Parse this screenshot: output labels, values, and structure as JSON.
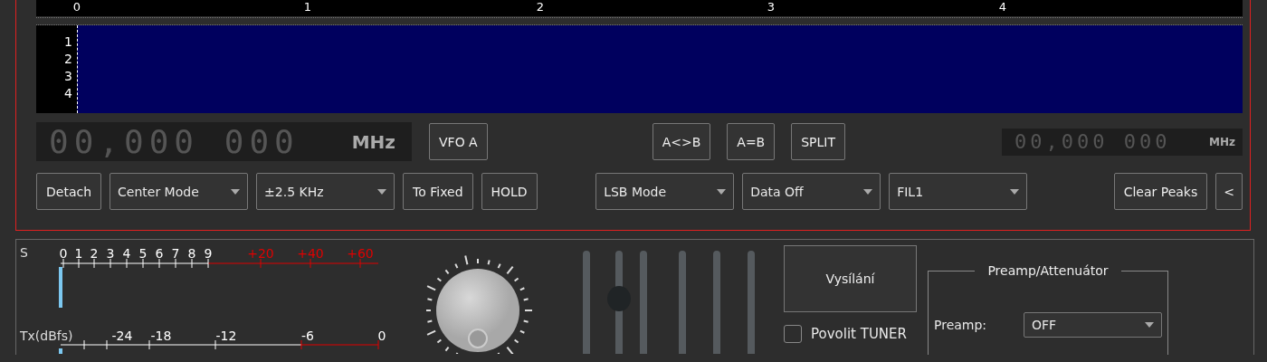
{
  "ruler": {
    "labels": [
      "0",
      "1",
      "2",
      "3",
      "4"
    ]
  },
  "waterfall": {
    "labels": [
      "1",
      "2",
      "3",
      "4"
    ]
  },
  "vfo_main": {
    "digits": "00,000 000",
    "unit": "MHz"
  },
  "vfo_button": "VFO A",
  "vfo_buttons": [
    "A<>B",
    "A=B",
    "SPLIT"
  ],
  "vfo_sub": {
    "digits": "00,000 000",
    "unit": "MHz"
  },
  "controls": [
    {
      "kind": "button",
      "label": "Detach"
    },
    {
      "kind": "dropdown",
      "label": "Center Mode"
    },
    {
      "kind": "dropdown",
      "label": "±2.5 KHz"
    },
    {
      "kind": "button",
      "label": "To Fixed"
    },
    {
      "kind": "button",
      "label": "HOLD"
    },
    {
      "kind": "spacer"
    },
    {
      "kind": "dropdown",
      "label": "LSB Mode"
    },
    {
      "kind": "dropdown",
      "label": "Data Off"
    },
    {
      "kind": "dropdown",
      "label": "FIL1"
    },
    {
      "kind": "spacer"
    },
    {
      "kind": "button",
      "label": "Clear Peaks"
    },
    {
      "kind": "button",
      "label": "<"
    }
  ],
  "s_meter": {
    "label": "S",
    "ticks": [
      {
        "label": "0",
        "color": "#ffffff"
      },
      {
        "label": "1",
        "color": "#ffffff"
      },
      {
        "label": "2",
        "color": "#ffffff"
      },
      {
        "label": "3",
        "color": "#ffffff"
      },
      {
        "label": "4",
        "color": "#ffffff"
      },
      {
        "label": "5",
        "color": "#ffffff"
      },
      {
        "label": "6",
        "color": "#ffffff"
      },
      {
        "label": "7",
        "color": "#ffffff"
      },
      {
        "label": "8",
        "color": "#ffffff"
      },
      {
        "label": "9",
        "color": "#ffffff"
      },
      {
        "label": "+20",
        "color": "#e00000"
      },
      {
        "label": "+40",
        "color": "#e00000"
      },
      {
        "label": "+60",
        "color": "#e00000"
      }
    ]
  },
  "tx_meter": {
    "label": "Tx(dBfs)",
    "ticks": [
      {
        "label": "-24",
        "color": "#ffffff"
      },
      {
        "label": "-18",
        "color": "#ffffff"
      },
      {
        "label": "-12",
        "color": "#ffffff"
      },
      {
        "label": "-6",
        "color": "#ffffff"
      },
      {
        "label": "0",
        "color": "#ffffff"
      }
    ]
  },
  "sliders": [
    {
      "kind": "bare"
    },
    {
      "kind": "thumb",
      "level": 0.55
    },
    {
      "kind": "bare"
    },
    {
      "kind": "bare"
    },
    {
      "kind": "bare"
    },
    {
      "kind": "bare"
    }
  ],
  "transmit_button": "Vysílání",
  "tuner": {
    "label": "Povolit TUNER",
    "checked": false
  },
  "preamp_group": {
    "title": "Preamp/Attenuátor",
    "preamp_label": "Preamp:",
    "preamp_value": "OFF"
  }
}
